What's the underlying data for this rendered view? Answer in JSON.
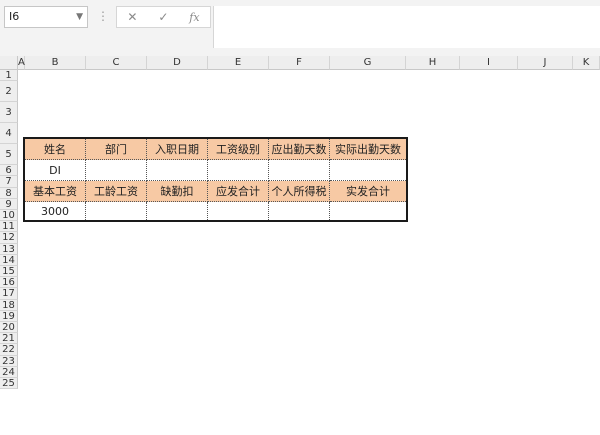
{
  "formula_bar": {
    "name_box": "I6",
    "cancel_symbol": "✕",
    "enter_symbol": "✓",
    "fx_label": "fx",
    "formula": ""
  },
  "columns": [
    "A",
    "B",
    "C",
    "D",
    "E",
    "F",
    "G",
    "H",
    "I",
    "J",
    "K"
  ],
  "rows": [
    "1",
    "2",
    "3",
    "4",
    "5",
    "6",
    "7",
    "8",
    "9",
    "10",
    "11",
    "12",
    "13",
    "14",
    "15",
    "16",
    "17",
    "18",
    "19",
    "20",
    "21",
    "22",
    "23",
    "24",
    "25"
  ],
  "table": {
    "row2": [
      "姓名",
      "部门",
      "入职日期",
      "工资级别",
      "应出勤天数",
      "实际出勤天数"
    ],
    "row3": [
      "DI",
      "",
      "",
      "",
      "",
      ""
    ],
    "row4": [
      "基本工资",
      "工龄工资",
      "缺勤扣",
      "应发合计",
      "个人所得税",
      "实发合计"
    ],
    "row5": [
      "3000",
      "",
      "",
      "",
      "",
      ""
    ]
  },
  "colors": {
    "header_fill": "#f7c9a4",
    "table_border": "#1a1a1a"
  }
}
